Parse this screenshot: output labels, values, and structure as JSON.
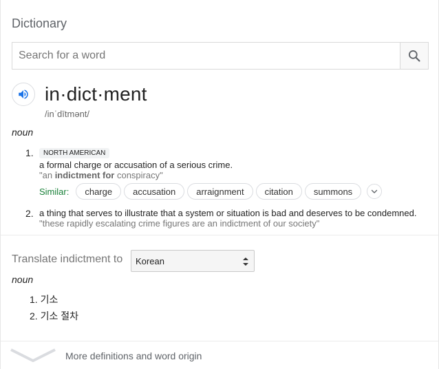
{
  "header": {
    "title": "Dictionary"
  },
  "search": {
    "placeholder": "Search for a word",
    "value": ""
  },
  "entry": {
    "headword": "in·dict·ment",
    "phonetic": "/inˈdītmənt/",
    "part_of_speech": "noun",
    "senses": [
      {
        "number": "1.",
        "region": "NORTH AMERICAN",
        "definition": "a formal charge or accusation of a serious crime.",
        "example_prefix": "\"an ",
        "example_bold": "indictment for",
        "example_suffix": " conspiracy\""
      },
      {
        "number": "2.",
        "definition": "a thing that serves to illustrate that a system or situation is bad and deserves to be condemned.",
        "example": "\"these rapidly escalating crime figures are an indictment of our society\""
      }
    ],
    "similar": {
      "label": "Similar:",
      "words": [
        "charge",
        "accusation",
        "arraignment",
        "citation",
        "summons"
      ]
    }
  },
  "translate": {
    "label": "Translate indictment to",
    "selected_language": "Korean",
    "part_of_speech": "noun",
    "items": [
      {
        "number": "1.",
        "text": "기소"
      },
      {
        "number": "2.",
        "text": "기소 절차"
      }
    ]
  },
  "footer": {
    "more_label": "More definitions and word origin"
  },
  "icons": {
    "search": "search-icon",
    "speaker": "speaker-icon",
    "expand": "chevron-down-icon",
    "more": "chevron-down-icon"
  },
  "colors": {
    "accent_blue": "#1a73e8",
    "similar_green": "#188038"
  }
}
